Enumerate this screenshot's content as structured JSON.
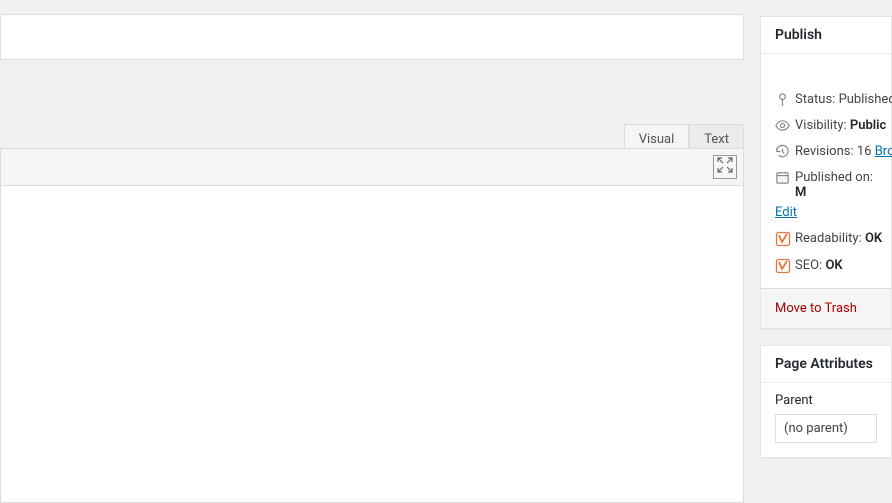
{
  "editor": {
    "tabs": {
      "visual": "Visual",
      "text": "Text"
    }
  },
  "publish": {
    "title": "Publish",
    "status_label": "Status:",
    "status_value": "Published",
    "visibility_label": "Visibility:",
    "visibility_value": "Public",
    "revisions_label": "Revisions:",
    "revisions_count": "16",
    "revisions_browse": "Bro",
    "published_label": "Published on:",
    "published_value": "M",
    "edit_link": "Edit",
    "readability_label": "Readability:",
    "readability_value": "OK",
    "seo_label": "SEO:",
    "seo_value": "OK",
    "trash": "Move to Trash"
  },
  "page_attributes": {
    "title": "Page Attributes",
    "parent_label": "Parent",
    "parent_value": "(no parent)"
  }
}
